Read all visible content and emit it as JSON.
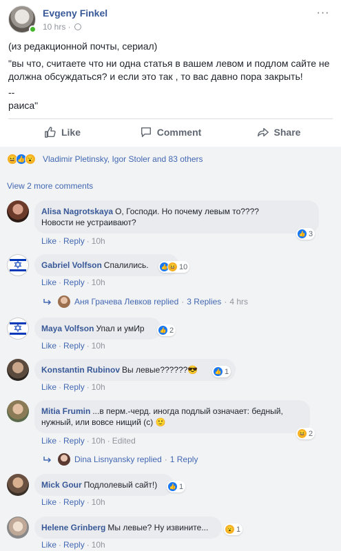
{
  "post": {
    "author": "Evgeny Finkel",
    "time": "10 hrs · ",
    "text_lines": [
      "(из редакционной почты, сериал)",
      "\"вы что, считаете что ни одна статья в вашем левом и подлом сайте не должна обсуждаться? и если это так , то вас давно пора закрыть!",
      "--",
      "раиса\""
    ],
    "actions": {
      "like": "Like",
      "comment": "Comment",
      "share": "Share"
    },
    "reactions_summary": "Vladimir Pletinsky, Igor Stoler and 83 others"
  },
  "view_more": "View 2 more comments",
  "comments": [
    {
      "name": "Alisa Nagrotskaya",
      "text": "О, Господи. Но почему левым то????",
      "text2": "Новости не устраивают?",
      "like": "Like",
      "reply": "Reply",
      "time": "10h",
      "reaction_count": "3"
    },
    {
      "name": "Gabriel Volfson",
      "text": "Спалились.",
      "like": "Like",
      "reply": "Reply",
      "time": "10h",
      "reaction_count": "10",
      "replies": {
        "who": "Аня Грачева Левков",
        "replied": "replied",
        "count": "3 Replies",
        "time": "4 hrs"
      }
    },
    {
      "name": "Maya Volfson",
      "text": "Упал и умИр",
      "like": "Like",
      "reply": "Reply",
      "time": "10h",
      "reaction_count": "2"
    },
    {
      "name": "Konstantin Rubinov",
      "text": "Вы левые??????😎",
      "like": "Like",
      "reply": "Reply",
      "time": "10h",
      "reaction_count": "1"
    },
    {
      "name": "Mitia Frumin",
      "text": "...в перм.-черд. иногда подлый означает: бедный,",
      "text2": "нужный, или вовсе нищий (с) 🙂",
      "like": "Like",
      "reply": "Reply",
      "time": "10h",
      "edited": "Edited",
      "reaction_count": "2",
      "replies": {
        "who": "Dina Lisnyansky",
        "replied": "replied",
        "count": "1 Reply"
      }
    },
    {
      "name": "Mick Gour",
      "text": "Подлолевый сайт!)",
      "like": "Like",
      "reply": "Reply",
      "time": "10h",
      "reaction_count": "1"
    },
    {
      "name": "Helene Grinberg",
      "text": "Мы левые? Ну извините...",
      "like": "Like",
      "reply": "Reply",
      "time": "10h",
      "reaction_count": "1"
    }
  ],
  "colors": {
    "link": "#385898",
    "meta_link": "#4267b2",
    "like_blue": "#1877f2",
    "haha": "#f7b125"
  },
  "icons": [
    "globe-icon",
    "more-icon",
    "like-icon",
    "comment-icon",
    "share-icon",
    "haha-icon",
    "wow-icon",
    "reply-arrow-icon"
  ]
}
